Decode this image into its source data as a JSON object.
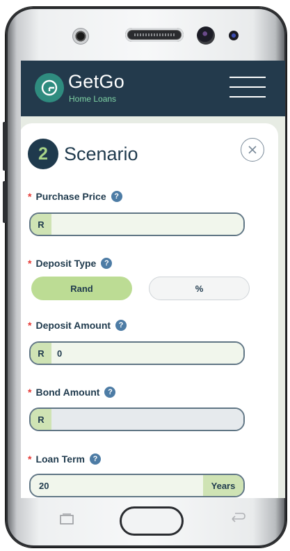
{
  "brand": {
    "name": "GetGo",
    "subtitle": "Home Loans"
  },
  "section": {
    "step_number": "2",
    "title": "Scenario"
  },
  "fields": {
    "purchase_price": {
      "label": "Purchase Price",
      "required": "*",
      "prefix": "R",
      "value": ""
    },
    "deposit_type": {
      "label": "Deposit Type",
      "required": "*",
      "options": [
        "Rand",
        "%"
      ],
      "selected": "Rand"
    },
    "deposit_amount": {
      "label": "Deposit Amount",
      "required": "*",
      "prefix": "R",
      "value": "0"
    },
    "bond_amount": {
      "label": "Bond Amount",
      "required": "*",
      "prefix": "R",
      "value": ""
    },
    "loan_term": {
      "label": "Loan Term",
      "required": "*",
      "value": "20",
      "suffix": "Years"
    }
  },
  "help_glyph": "?",
  "colors": {
    "header_bg": "#233a4c",
    "accent_green": "#a8d488",
    "required_red": "#e53935",
    "help_blue": "#4d7ca5"
  },
  "icons": [
    "menu-icon",
    "close-icon",
    "help-icon",
    "logo-icon",
    "recent-apps-icon",
    "home-button",
    "back-icon"
  ]
}
